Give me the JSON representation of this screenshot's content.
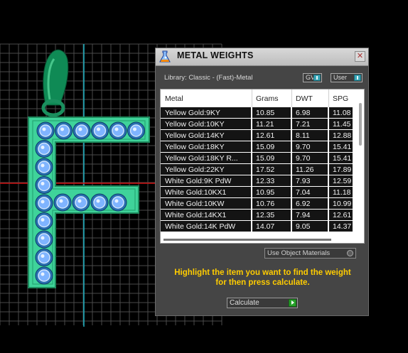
{
  "panel": {
    "title": "METAL WEIGHTS",
    "close_glyph": "✕",
    "library_label": "Library: Classic - (Fast)-Metal",
    "toggles": [
      {
        "label": "GV",
        "state": "on"
      },
      {
        "label": "User",
        "state": "on"
      }
    ],
    "table": {
      "headers": [
        "Metal",
        "Grams",
        "DWT",
        "SPG"
      ],
      "rows": [
        [
          "Yellow Gold:9KY",
          "10.85",
          "6.98",
          "11.08"
        ],
        [
          "Yellow Gold:10KY",
          "11.21",
          "7.21",
          "11.45"
        ],
        [
          "Yellow Gold:14KY",
          "12.61",
          "8.11",
          "12.88"
        ],
        [
          "Yellow Gold:18KY",
          "15.09",
          "9.70",
          "15.41"
        ],
        [
          "Yellow Gold:18KY R...",
          "15.09",
          "9.70",
          "15.41"
        ],
        [
          "Yellow Gold:22KY",
          "17.52",
          "11.26",
          "17.89"
        ],
        [
          "White Gold:9K PdW",
          "12.33",
          "7.93",
          "12.59"
        ],
        [
          "White Gold:10KX1",
          "10.95",
          "7.04",
          "11.18"
        ],
        [
          "White Gold:10KW",
          "10.76",
          "6.92",
          "10.99"
        ],
        [
          "White Gold:14KX1",
          "12.35",
          "7.94",
          "12.61"
        ],
        [
          "White Gold:14K PdW",
          "14.07",
          "9.05",
          "14.37"
        ]
      ]
    },
    "use_object_materials": "Use Object Materials",
    "instruction_line1": "Highlight the item you want to find the weight",
    "instruction_line2": "for then press calculate.",
    "calculate_label": "Calculate"
  },
  "icons": {
    "panel_icon": "flask-icon",
    "close": "close-icon",
    "calculate": "play-arrow-icon"
  },
  "colors": {
    "model_green": "#3fd39a",
    "gem_blue": "#7fb4ff",
    "instruction_yellow": "#ffcc00",
    "grid_line": "#4a4a4a",
    "axis_red": "#d01010",
    "axis_cyan": "#1bb3c4"
  }
}
